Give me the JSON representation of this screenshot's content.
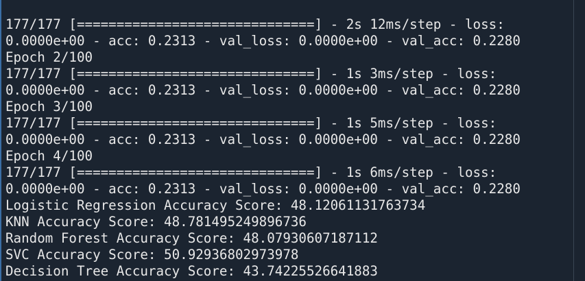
{
  "terminal": {
    "lines": [
      "177/177 [==============================] - 2s 12ms/step - loss:",
      "0.0000e+00 - acc: 0.2313 - val_loss: 0.0000e+00 - val_acc: 0.2280",
      "Epoch 2/100",
      "177/177 [==============================] - 1s 3ms/step - loss:",
      "0.0000e+00 - acc: 0.2313 - val_loss: 0.0000e+00 - val_acc: 0.2280",
      "Epoch 3/100",
      "177/177 [==============================] - 1s 5ms/step - loss:",
      "0.0000e+00 - acc: 0.2313 - val_loss: 0.0000e+00 - val_acc: 0.2280",
      "Epoch 4/100",
      "177/177 [==============================] - 1s 6ms/step - loss:",
      "0.0000e+00 - acc: 0.2313 - val_loss: 0.0000e+00 - val_acc: 0.2280",
      "Logistic Regression Accuracy Score: 48.12061131763734",
      "KNN Accuracy Score: 48.781495249896736",
      "Random Forest Accuracy Score: 48.07930607187112",
      "SVC Accuracy Score: 50.92936802973978",
      "Decision Tree Accuracy Score: 43.74225526641883"
    ]
  }
}
